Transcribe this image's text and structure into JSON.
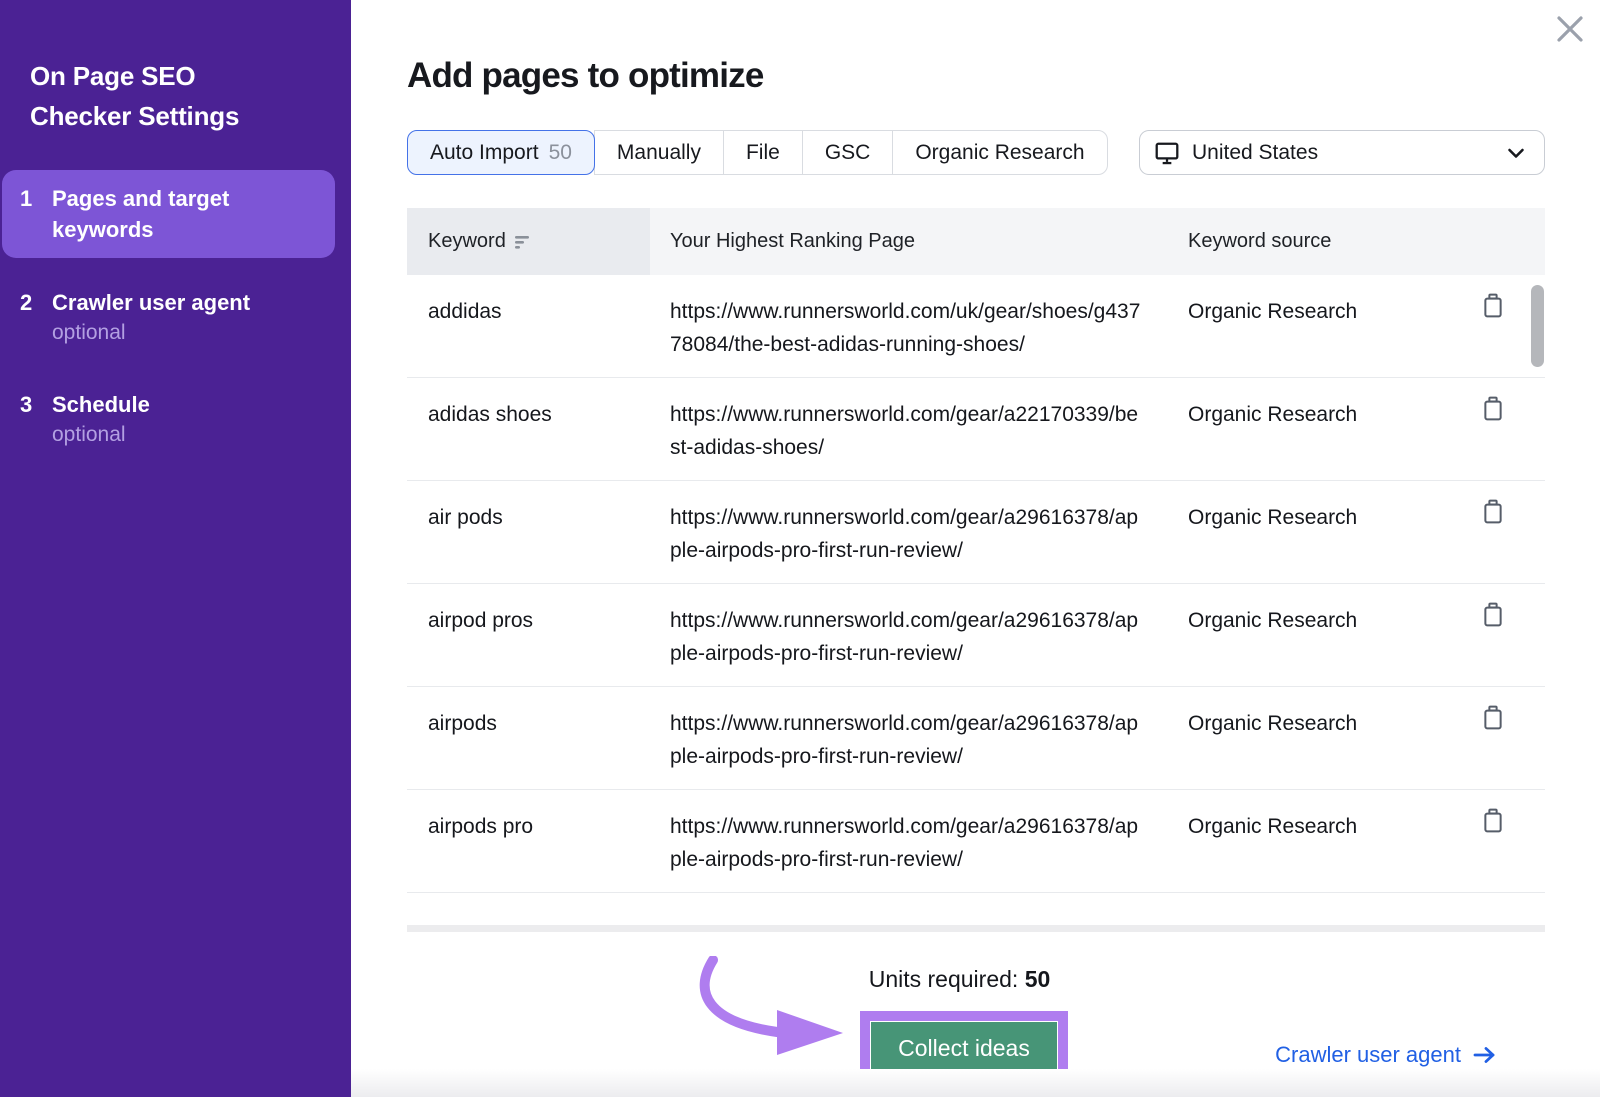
{
  "sidebar": {
    "title": "On Page SEO Checker Settings",
    "steps": [
      {
        "number": "1",
        "label": "Pages and target keywords",
        "optional": "",
        "active": true
      },
      {
        "number": "2",
        "label": "Crawler user agent",
        "optional": "optional",
        "active": false
      },
      {
        "number": "3",
        "label": "Schedule",
        "optional": "optional",
        "active": false
      }
    ]
  },
  "header": {
    "title": "Add pages to optimize"
  },
  "tabs": [
    {
      "label": "Auto Import",
      "count": "50",
      "active": true
    },
    {
      "label": "Manually",
      "count": "",
      "active": false
    },
    {
      "label": "File",
      "count": "",
      "active": false
    },
    {
      "label": "GSC",
      "count": "",
      "active": false
    },
    {
      "label": "Organic Research",
      "count": "",
      "active": false
    }
  ],
  "location_select": {
    "value": "United States"
  },
  "table": {
    "columns": [
      "Keyword",
      "Your Highest Ranking Page",
      "Keyword source"
    ],
    "rows": [
      {
        "keyword": "addidas",
        "url": "https://www.runnersworld.com/uk/gear/shoes/g43778084/the-best-adidas-running-shoes/",
        "source": "Organic Research"
      },
      {
        "keyword": "adidas shoes",
        "url": "https://www.runnersworld.com/gear/a22170339/best-adidas-shoes/",
        "source": "Organic Research"
      },
      {
        "keyword": "air pods",
        "url": "https://www.runnersworld.com/gear/a29616378/apple-airpods-pro-first-run-review/",
        "source": "Organic Research"
      },
      {
        "keyword": "airpod pros",
        "url": "https://www.runnersworld.com/gear/a29616378/apple-airpods-pro-first-run-review/",
        "source": "Organic Research"
      },
      {
        "keyword": "airpods",
        "url": "https://www.runnersworld.com/gear/a29616378/apple-airpods-pro-first-run-review/",
        "source": "Organic Research"
      },
      {
        "keyword": "airpods pro",
        "url": "https://www.runnersworld.com/gear/a29616378/apple-airpods-pro-first-run-review/",
        "source": "Organic Research"
      }
    ]
  },
  "footer": {
    "units_label": "Units required:",
    "units_value": "50",
    "collect_button": "Collect ideas",
    "crawler_link": "Crawler user agent"
  },
  "colors": {
    "sidebar_bg": "#4B2294",
    "sidebar_active_step": "#7D55D6",
    "annotation_purple": "#AF7DEF",
    "button_green": "#479577",
    "link_blue": "#2160E4",
    "tab_active_border": "#4472E8",
    "tab_active_bg": "#EDF3FE"
  }
}
